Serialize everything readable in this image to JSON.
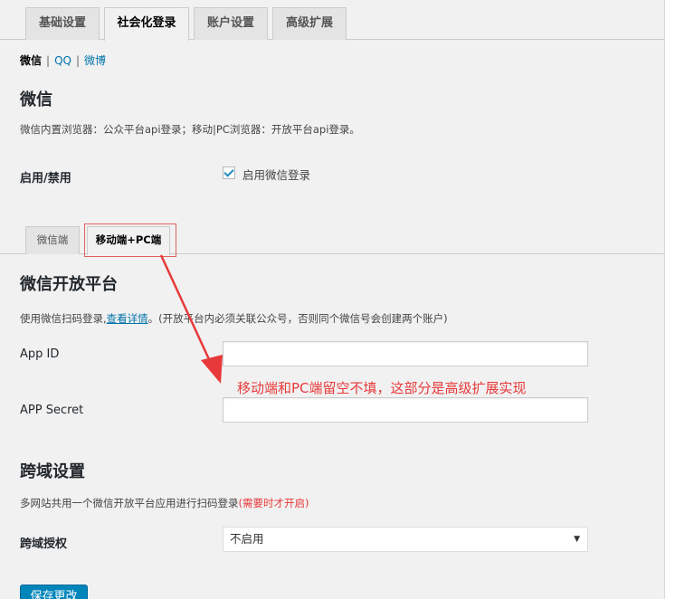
{
  "top_tabs": [
    "基础设置",
    "社会化登录",
    "账户设置",
    "高级扩展"
  ],
  "subnav": {
    "current": "微信",
    "sep": "|",
    "qq": "QQ",
    "weibo": "微博"
  },
  "wechat_section": {
    "title": "微信",
    "desc": "微信内置浏览器：公众平台api登录；移动|PC浏览器：开放平台api登录。",
    "enable_label": "启用/禁用",
    "checkbox_label": "启用微信登录",
    "checkbox_checked": true
  },
  "inner_tabs": [
    "微信端",
    "移动端+PC端"
  ],
  "open_platform": {
    "title": "微信开放平台",
    "desc_before": "使用微信扫码登录,",
    "link": "查看详情",
    "desc_after": "。(开放平台内必须关联公众号，否则同个微信号会创建两个账户)",
    "app_id_label": "App ID",
    "app_id_value": "",
    "app_secret_label": "APP Secret",
    "app_secret_value": ""
  },
  "annotation": "移动端和PC端留空不填，这部分是高级扩展实现",
  "annotation_color": "#e8393a",
  "crossdomain": {
    "title": "跨域设置",
    "desc": "多网站共用一个微信开放平台应用进行扫码登录",
    "desc_note": "(需要时才开启)",
    "note_color": "#e8393a",
    "label": "跨域授权",
    "select_value": "不启用"
  },
  "save_button": "保存更改",
  "accent_color": "#0085ba"
}
